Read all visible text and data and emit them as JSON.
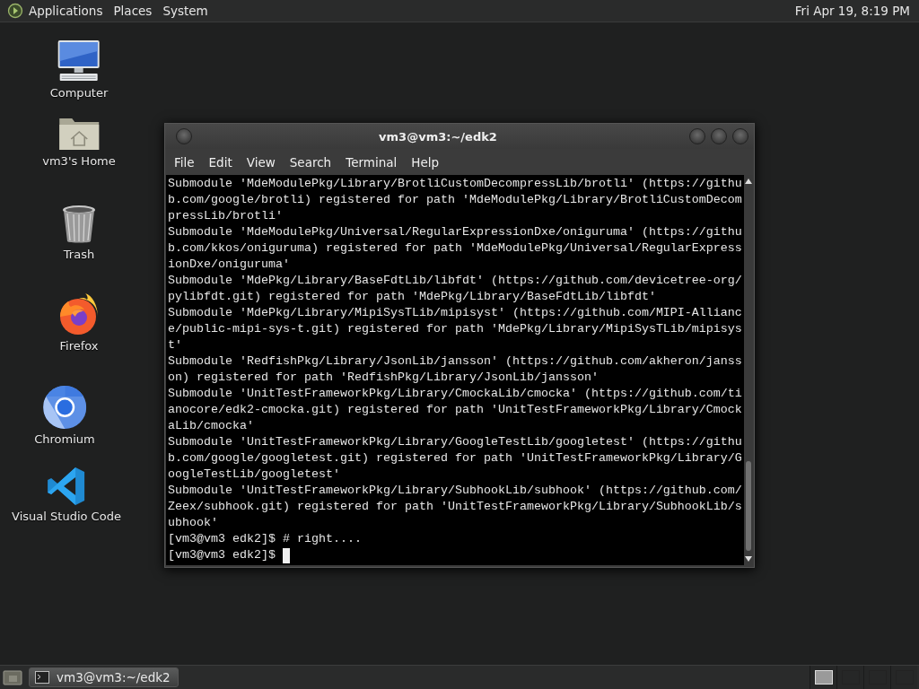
{
  "top_panel": {
    "menus": [
      "Applications",
      "Places",
      "System"
    ],
    "clock": "Fri Apr 19,  8:19 PM"
  },
  "desktop_icons": [
    {
      "label": "Computer",
      "kind": "computer"
    },
    {
      "label": "vm3's Home",
      "kind": "home"
    },
    {
      "label": "Trash",
      "kind": "trash"
    },
    {
      "label": "Firefox",
      "kind": "firefox"
    },
    {
      "label": "Chromium",
      "kind": "chromium"
    },
    {
      "label": "Visual Studio Code",
      "kind": "vscode"
    }
  ],
  "terminal": {
    "title": "vm3@vm3:~/edk2",
    "menu": [
      "File",
      "Edit",
      "View",
      "Search",
      "Terminal",
      "Help"
    ],
    "lines": [
      "Submodule 'MdeModulePkg/Library/BrotliCustomDecompressLib/brotli' (https://githu",
      "b.com/google/brotli) registered for path 'MdeModulePkg/Library/BrotliCustomDecom",
      "pressLib/brotli'",
      "Submodule 'MdeModulePkg/Universal/RegularExpressionDxe/oniguruma' (https://githu",
      "b.com/kkos/oniguruma) registered for path 'MdeModulePkg/Universal/RegularExpress",
      "ionDxe/oniguruma'",
      "Submodule 'MdePkg/Library/BaseFdtLib/libfdt' (https://github.com/devicetree-org/",
      "pylibfdt.git) registered for path 'MdePkg/Library/BaseFdtLib/libfdt'",
      "Submodule 'MdePkg/Library/MipiSysTLib/mipisyst' (https://github.com/MIPI-Allianc",
      "e/public-mipi-sys-t.git) registered for path 'MdePkg/Library/MipiSysTLib/mipisys",
      "t'",
      "Submodule 'RedfishPkg/Library/JsonLib/jansson' (https://github.com/akheron/janss",
      "on) registered for path 'RedfishPkg/Library/JsonLib/jansson'",
      "Submodule 'UnitTestFrameworkPkg/Library/CmockaLib/cmocka' (https://github.com/ti",
      "anocore/edk2-cmocka.git) registered for path 'UnitTestFrameworkPkg/Library/Cmock",
      "aLib/cmocka'",
      "Submodule 'UnitTestFrameworkPkg/Library/GoogleTestLib/googletest' (https://githu",
      "b.com/google/googletest.git) registered for path 'UnitTestFrameworkPkg/Library/G",
      "oogleTestLib/googletest'",
      "Submodule 'UnitTestFrameworkPkg/Library/SubhookLib/subhook' (https://github.com/",
      "Zeex/subhook.git) registered for path 'UnitTestFrameworkPkg/Library/SubhookLib/s",
      "ubhook'",
      "[vm3@vm3 edk2]$ # right....",
      "[vm3@vm3 edk2]$"
    ]
  },
  "bottom_panel": {
    "tasks": [
      {
        "label": "vm3@vm3:~/edk2",
        "selected": true
      }
    ],
    "workspaces": [
      {
        "selected": true
      },
      {
        "selected": false
      },
      {
        "selected": false
      },
      {
        "selected": false
      }
    ]
  }
}
